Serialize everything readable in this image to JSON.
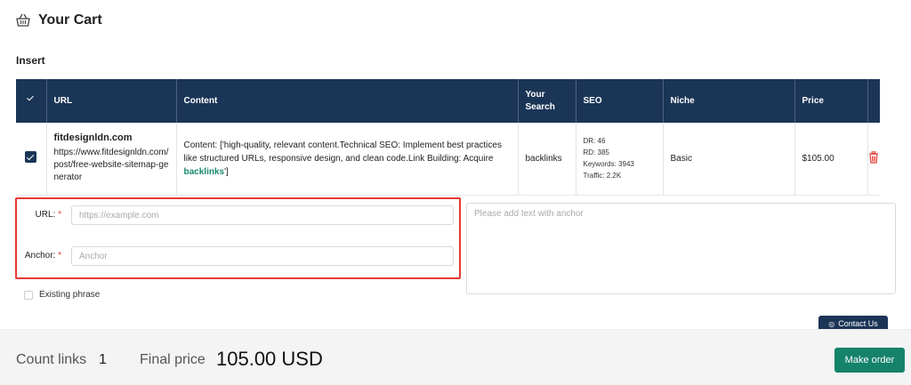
{
  "header": {
    "title": "Your Cart",
    "icon": "basket-icon"
  },
  "section": {
    "label": "Insert"
  },
  "table": {
    "columns": [
      "URL",
      "Content",
      "Your Search",
      "SEO",
      "Niche",
      "Price"
    ],
    "row": {
      "checked": true,
      "site_name": "fitdesignldn.com",
      "site_url": "https://www.fitdesignldn.com/post/free-website-sitemap-generator",
      "content_prefix": "Content: ['high-quality, relevant content.Technical SEO: Implement best practices like structured URLs, responsive design, and clean code.Link Building: Acquire ",
      "content_link": "backlinks",
      "content_suffix": "']",
      "search": "backlinks",
      "seo": {
        "dr": "DR: 46",
        "rd": "RD: 385",
        "keywords": "Keywords: 3943",
        "traffic": "Traffic: 2.2K"
      },
      "niche": "Basic",
      "price": "$105.00"
    }
  },
  "form": {
    "url_label": "URL:",
    "url_placeholder": "https://example.com",
    "anchor_label": "Anchor:",
    "anchor_placeholder": "Anchor",
    "required_mark": "*",
    "text_placeholder": "Please add text with anchor",
    "existing_phrase_label": "Existing phrase",
    "existing_phrase_checked": false
  },
  "contact_button": "Contact Us",
  "footer": {
    "count_label": "Count links",
    "count_value": "1",
    "price_label": "Final price",
    "price_value": "105.00 USD",
    "order_button": "Make order"
  },
  "colors": {
    "header_bg": "#1b3557",
    "accent_green": "#15826a",
    "highlight_red": "#e53935",
    "delete_red": "#e53935"
  }
}
